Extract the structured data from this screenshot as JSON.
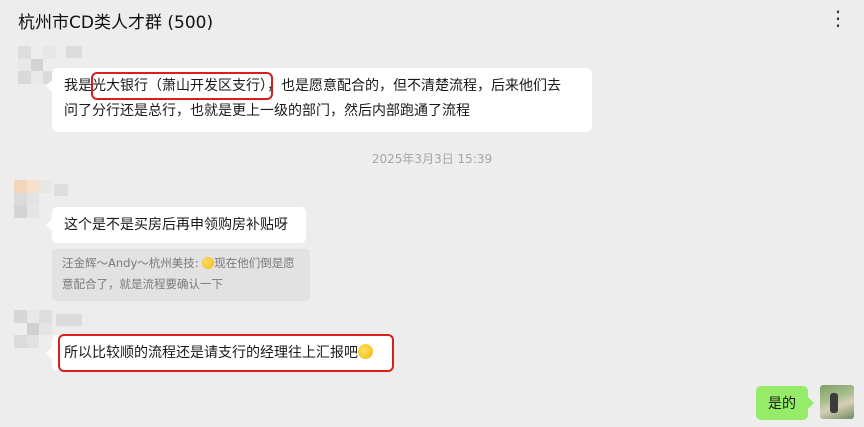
{
  "header": {
    "title": "杭州市CD类人才群",
    "member_count": "(500)",
    "more_icon": "⋮"
  },
  "messages": [
    {
      "lines": [
        "我是光大银行（萧山开发区支行），也是愿意配合的，但不清楚流程，后来他们去",
        "问了分行还是总行，也就是更上一级的部门，然后内部跑通了流程"
      ]
    },
    {
      "text": "这个是不是买房后再申领购房补贴呀"
    },
    {
      "text": "所以比较顺的流程还是请支行的经理往上汇报吧",
      "emoji": "grinning-sweat-emoji"
    },
    {
      "text": "是的"
    }
  ],
  "timestamp": "2025年3月3日 15:39",
  "quote": {
    "line1_before_emoji": "汪金辉～Andy～杭州美技: ",
    "line1_after_emoji": "现在他们倒是愿",
    "line2": "意配合了，就是流程要确认一下",
    "emoji": "grinning-sweat-emoji"
  },
  "colors": {
    "highlight": "#d81e1e",
    "self_bubble": "#95ec69",
    "background": "#ededed"
  }
}
